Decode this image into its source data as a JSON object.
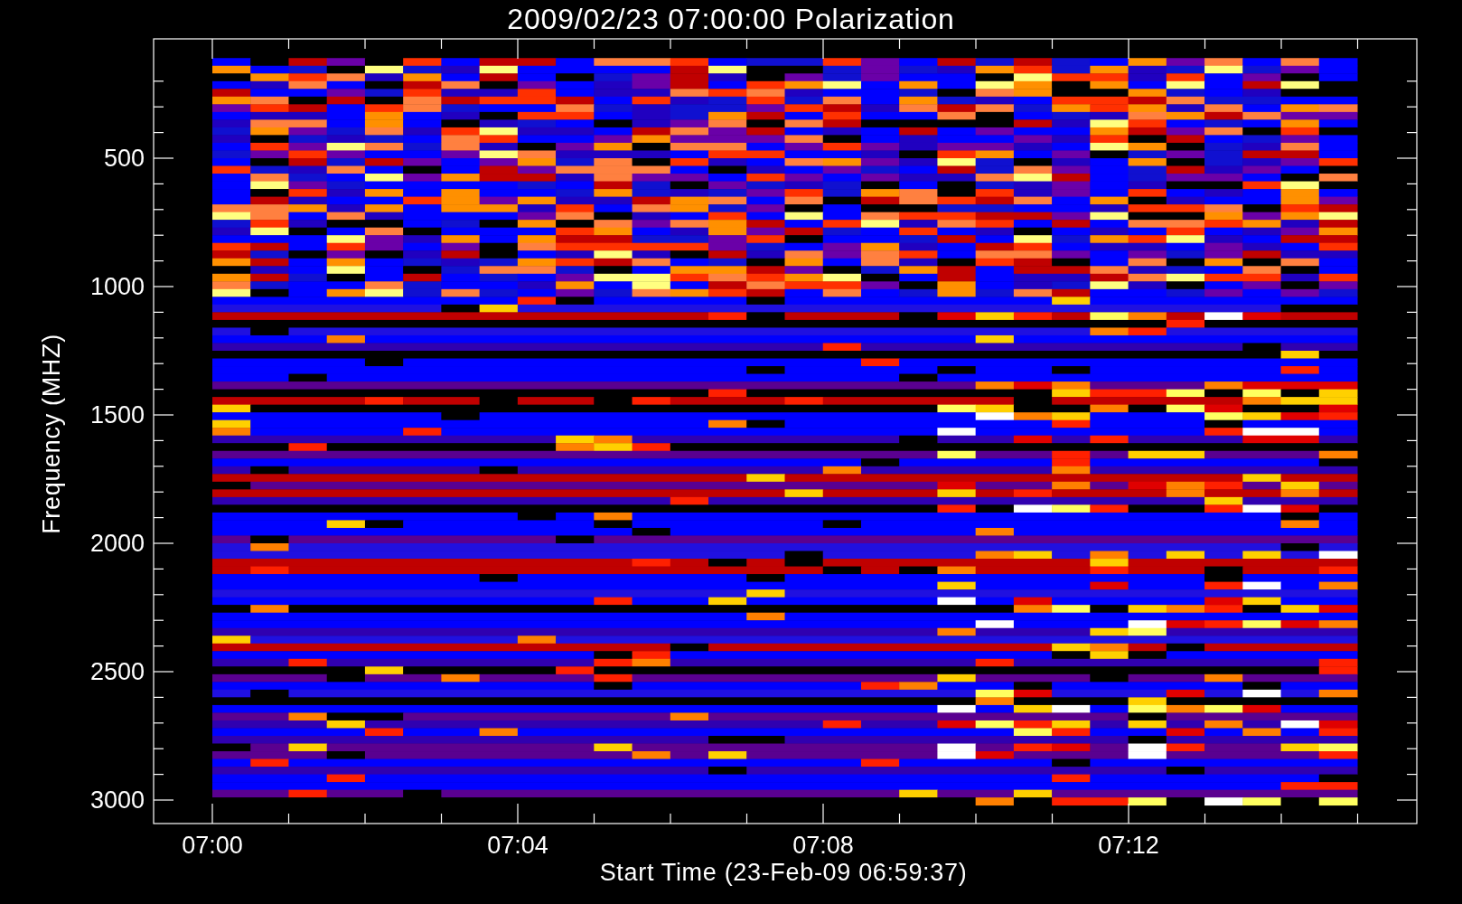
{
  "title": "2009/02/23 07:00:00 Polarization",
  "y_axis": {
    "label": "Frequency (MHZ)",
    "ticks": [
      "500",
      "1000",
      "1500",
      "2000",
      "2500",
      "3000"
    ]
  },
  "x_axis": {
    "label": "Start Time (23-Feb-09 06:59:37)",
    "ticks": [
      "07:00",
      "07:04",
      "07:08",
      "07:12"
    ]
  }
}
